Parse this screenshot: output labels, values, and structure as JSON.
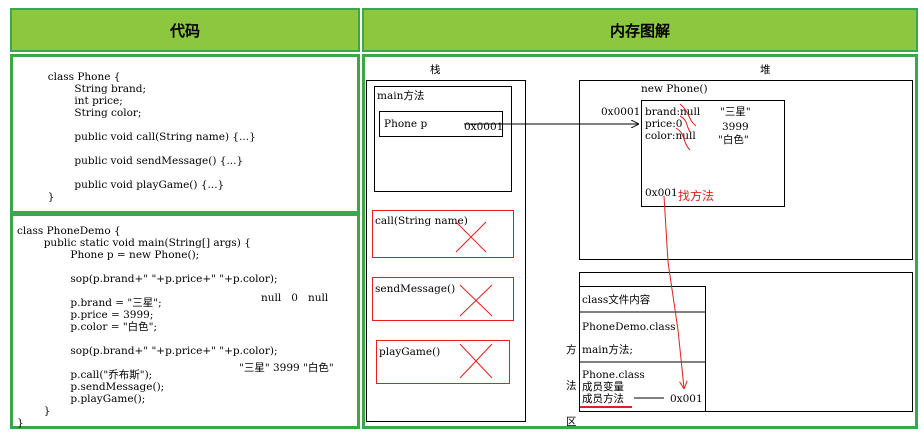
{
  "headers": {
    "code": "代码",
    "memory": "内存图解"
  },
  "phone_class": [
    "        class Phone {",
    "                String brand;",
    "                int price;",
    "                String color;",
    "",
    "                public void call(String name) {...}",
    "",
    "                public void sendMessage() {...}",
    "",
    "                public void playGame() {...}",
    "        }"
  ],
  "demo_class": [
    "class PhoneDemo {",
    "        public static void main(String[] args) {",
    "                Phone p = new Phone();",
    "",
    "                sop(p.brand+\" \"+p.price+\" \"+p.color);",
    "",
    "                p.brand = \"三星\";",
    "                p.price = 3999;",
    "                p.color = \"白色\";",
    "",
    "                sop(p.brand+\" \"+p.price+\" \"+p.color);",
    "",
    "                p.call(\"乔布斯\");",
    "                p.sendMessage();",
    "                p.playGame();",
    "        }",
    "}"
  ],
  "output1": "null   0   null",
  "output2": "\"三星\" 3999 \"白色\"",
  "stack": {
    "title": "栈",
    "main_label": "main方法",
    "var_name": "Phone p",
    "var_value": "0x0001",
    "frames": [
      "call(String name)",
      "sendMessage()",
      "playGame()"
    ]
  },
  "heap": {
    "title": "堆",
    "obj_label": "new Phone()",
    "address": "0x0001",
    "fields": [
      "brand:null",
      "price:0",
      "color:null"
    ],
    "new_values": [
      "\"三星\"",
      "3999",
      "\"白色\""
    ],
    "method_addr": "0x001",
    "find_method": "找方法"
  },
  "method_area": {
    "side_label": [
      "方",
      "法",
      "区"
    ],
    "class_file": "class文件内容",
    "phonedemo": "PhoneDemo.class",
    "main_method": "main方法;",
    "phone_class": "Phone.class",
    "member_vars": "成员变量",
    "member_methods": "成员方法",
    "method_addr": "0x001"
  },
  "colors": {
    "header_bg": "#8dc63f",
    "border_green": "#3aa84a",
    "annotation_red": "#e02020"
  }
}
